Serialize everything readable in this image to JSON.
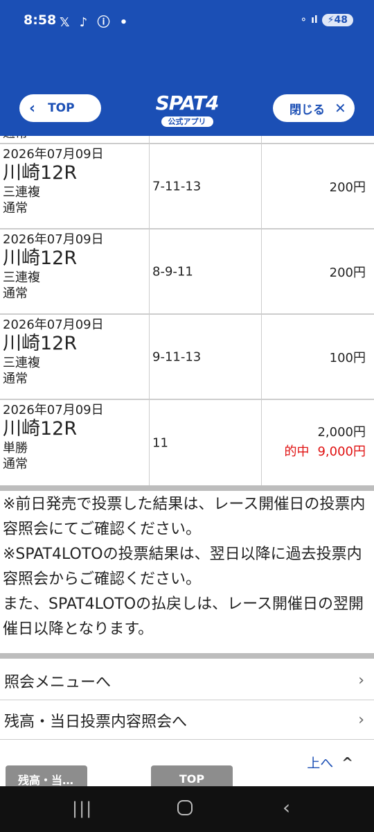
{
  "status": {
    "time": "8:58",
    "left_icons": "𝕏 ♪ ⓘ •",
    "signal": "⚬ ıl",
    "battery": "48"
  },
  "header": {
    "back_label": "TOP",
    "logo_main": "SPAT4",
    "logo_sub": "公式アプリ",
    "close_label": "閉じる"
  },
  "table": {
    "partial_row_text": "通常",
    "rows": [
      {
        "date": "2026年07月09日",
        "race": "川崎12R",
        "bet_type": "三連複",
        "method": "通常",
        "combo": "7-11-13",
        "amount": "200円"
      },
      {
        "date": "2026年07月09日",
        "race": "川崎12R",
        "bet_type": "三連複",
        "method": "通常",
        "combo": "8-9-11",
        "amount": "200円"
      },
      {
        "date": "2026年07月09日",
        "race": "川崎12R",
        "bet_type": "三連複",
        "method": "通常",
        "combo": "9-11-13",
        "amount": "100円"
      },
      {
        "date": "2026年07月09日",
        "race": "川崎12R",
        "bet_type": "単勝",
        "method": "通常",
        "combo": "11",
        "amount": "2,000円",
        "hit_label": "的中",
        "hit_amount": "9,000円"
      }
    ]
  },
  "notes": {
    "line1": "※前日発売で投票した結果は、レース開催日の投票内容照会にてご確認ください。",
    "line2": "※SPAT4LOTOの投票結果は、翌日以降に過去投票内容照会からご確認ください。",
    "line3": "また、SPAT4LOTOの払戻しは、レース開催日の翌開催日以降となります。"
  },
  "menu": {
    "item1": "照会メニューへ",
    "item2": "残高・当日投票内容照会へ"
  },
  "footer": {
    "up_label": "上へ",
    "tab_left": "残高・当…",
    "tab_center": "TOP"
  },
  "colors": {
    "header_blue": "#1b4fb5",
    "hit_red": "#e01010"
  }
}
